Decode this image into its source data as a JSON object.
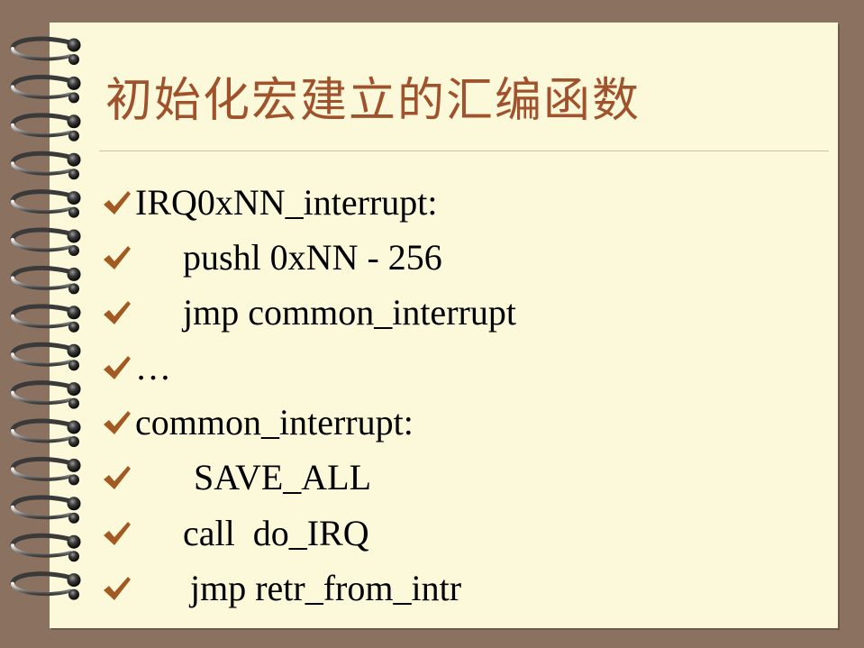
{
  "slide": {
    "title": "初始化宏建立的汇编函数",
    "check_color": "#a35a22",
    "background_color": "#fbf9da",
    "frame_color": "#8b7260",
    "title_color": "#a0522d",
    "bullet_icon": "check-icon",
    "lines": [
      {
        "text": "IRQ0xNN_interrupt:"
      },
      {
        "text": "pushl 0xNN - 256"
      },
      {
        "text": "jmp common_interrupt"
      },
      {
        "text": "…"
      },
      {
        "text": "common_interrupt:"
      },
      {
        "text": "SAVE_ALL"
      },
      {
        "text": "call  do_IRQ"
      },
      {
        "text": "jmp retr_from_intr"
      }
    ]
  }
}
